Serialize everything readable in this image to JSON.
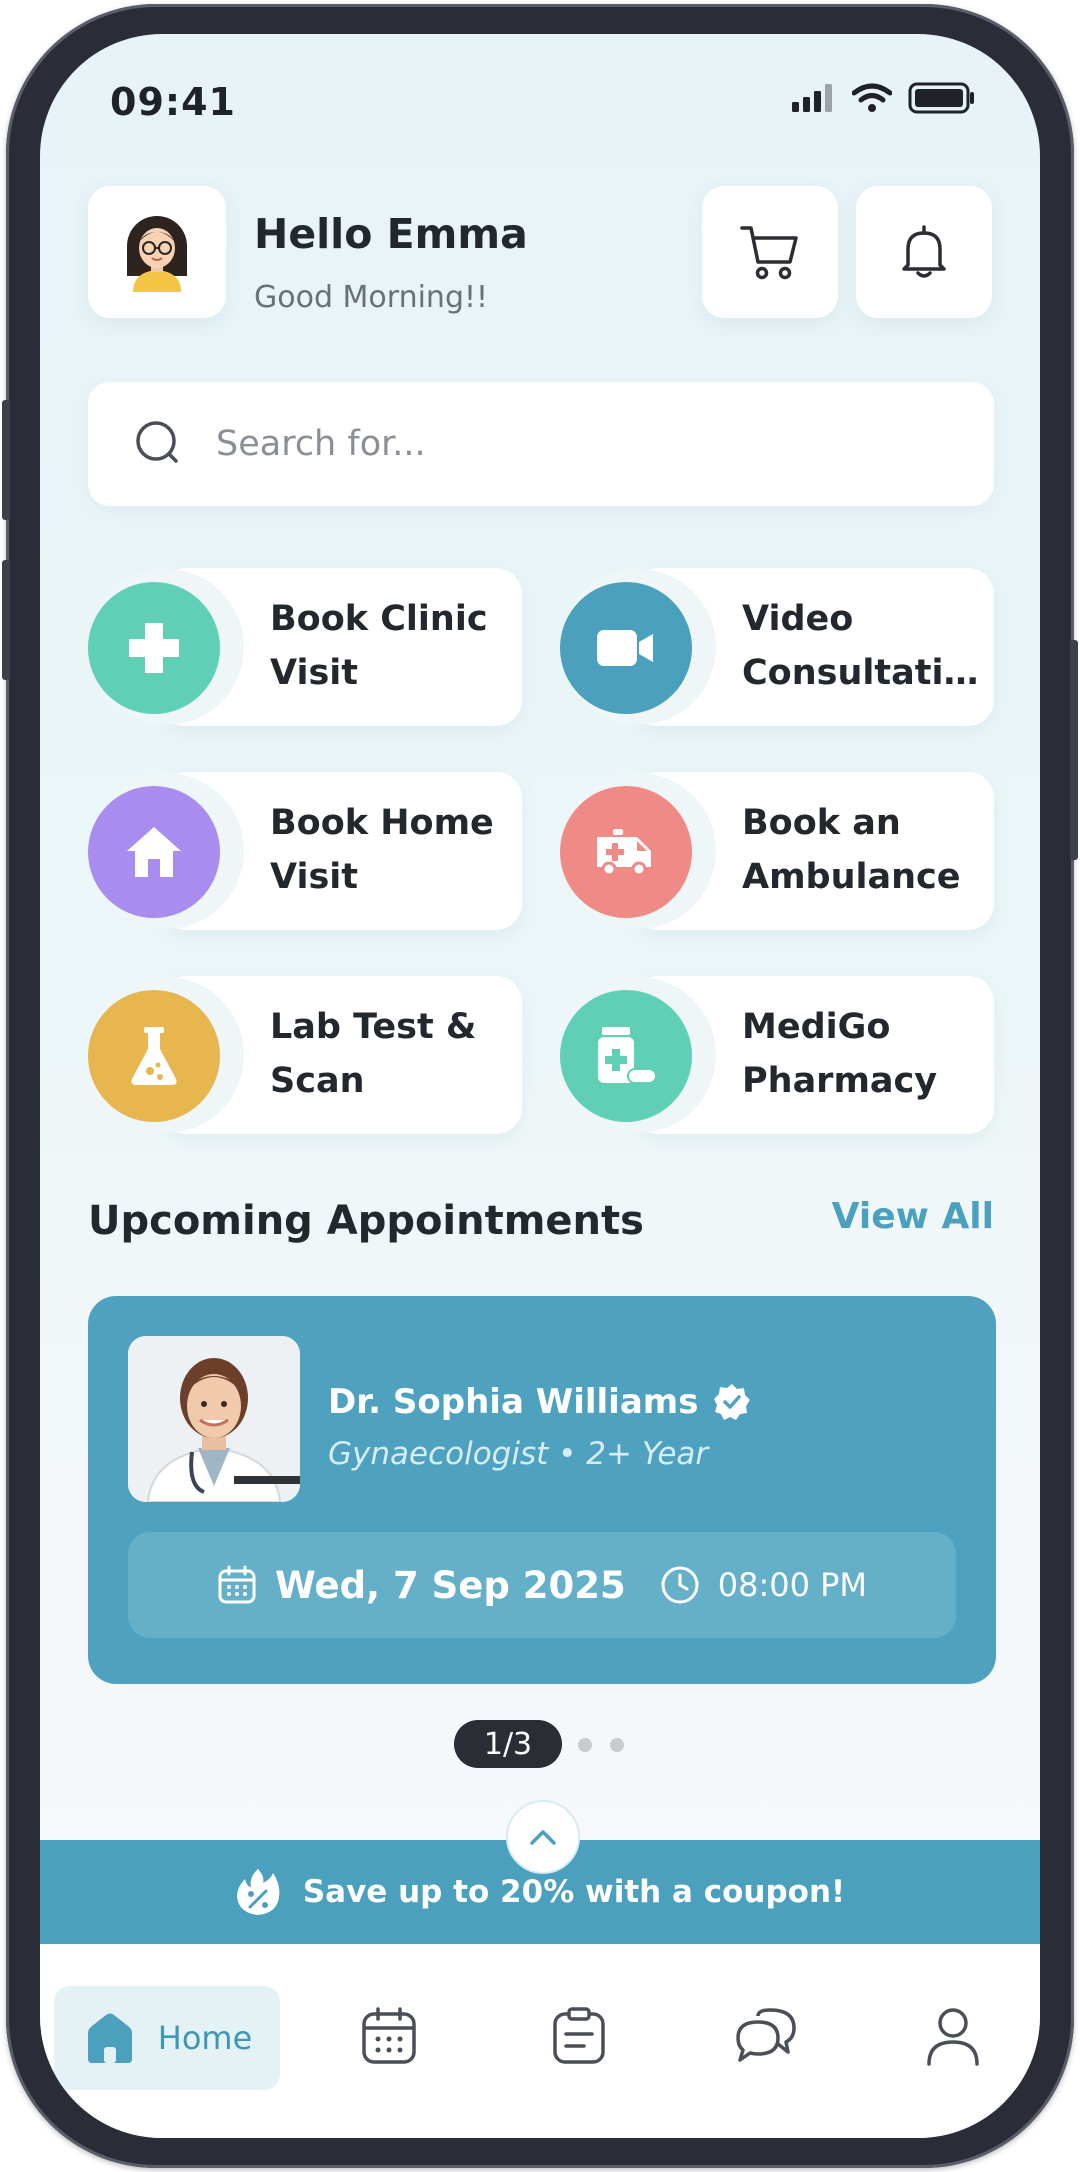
{
  "status_bar": {
    "time": "09:41"
  },
  "header": {
    "greeting": "Hello Emma",
    "subtitle": "Good Morning!!"
  },
  "search": {
    "placeholder": "Search for..."
  },
  "services": [
    {
      "line1": "Book Clinic",
      "line2": "Visit",
      "icon": "plus-icon",
      "color": "#5fd0b5"
    },
    {
      "line1": "Video",
      "line2": "Consultati...",
      "icon": "video-camera-icon",
      "color": "#4aa0bd"
    },
    {
      "line1": "Book Home",
      "line2": "Visit",
      "icon": "home-icon",
      "color": "#a98cf0"
    },
    {
      "line1": "Book an",
      "line2": "Ambulance",
      "icon": "ambulance-icon",
      "color": "#ef8a86"
    },
    {
      "line1": "Lab Test &",
      "line2": "Scan",
      "icon": "flask-icon",
      "color": "#e7b64f"
    },
    {
      "line1": "MediGo",
      "line2": "Pharmacy",
      "icon": "pill-bottle-icon",
      "color": "#5fd0b5"
    }
  ],
  "appointments": {
    "section_title": "Upcoming Appointments",
    "view_all": "View All",
    "doctor_name": "Dr. Sophia Williams",
    "doctor_specialty": "Gynaecologist • 2+ Year",
    "date": "Wed, 7 Sep 2025",
    "time": "08:00 PM",
    "pager": "1/3"
  },
  "promo": {
    "text": "Save up to 20% with a coupon!"
  },
  "nav": {
    "home_label": "Home"
  },
  "colors": {
    "accent": "#4aa0bd",
    "card_bg": "#4ea2c0",
    "text_dark": "#23272e"
  }
}
